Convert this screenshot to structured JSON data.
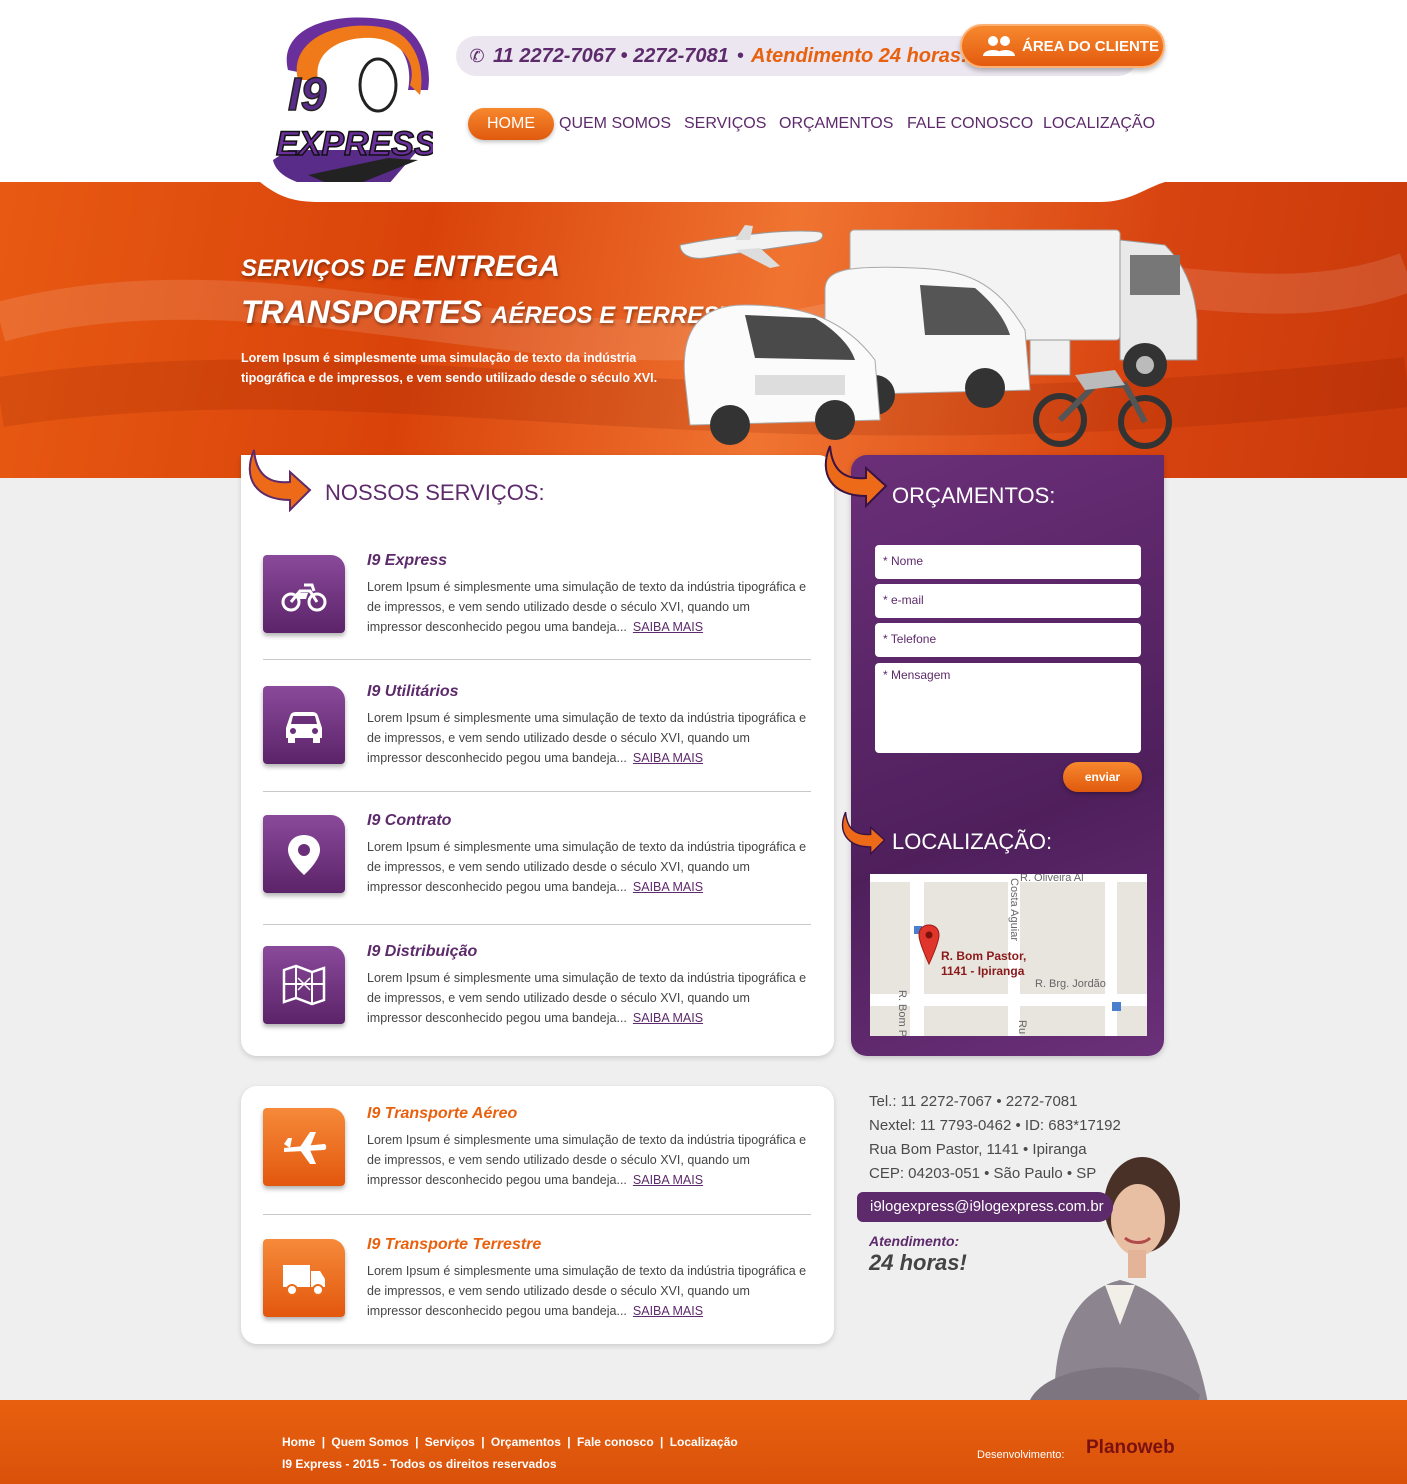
{
  "header": {
    "logo_text_top": "I9",
    "logo_text_bottom": "EXPRESS",
    "phone": "11 2272-7067 • 2272-7081",
    "separator": "•",
    "atendimento": "Atendimento 24 horas!",
    "client_area": "ÁREA DO CLIENTE"
  },
  "nav": {
    "items": [
      "HOME",
      "QUEM SOMOS",
      "SERVIÇOS",
      "ORÇAMENTOS",
      "FALE CONOSCO",
      "LOCALIZAÇÃO"
    ]
  },
  "banner": {
    "line1_small": "SERVIÇOS DE",
    "line1_big": "ENTREGA",
    "line2_big": "TRANSPORTES",
    "line2_small": "AÉREOS E TERRESTRES",
    "description": "Lorem Ipsum é simplesmente uma simulação de texto da indústria tipográfica e de impressos, e vem sendo utilizado desde o século XVI."
  },
  "services": {
    "heading": "NOSSOS SERVIÇOS:",
    "more": "SAIBA MAIS",
    "text": "Lorem Ipsum é simplesmente uma simulação de texto da indústria tipográfica e de impressos, e vem sendo utilizado desde o século XVI, quando um impressor desconhecido pegou uma bandeja...",
    "items": [
      {
        "title": "I9 Express",
        "icon": "motorcycle-icon"
      },
      {
        "title": "I9 Utilitários",
        "icon": "car-icon"
      },
      {
        "title": "I9 Contrato",
        "icon": "map-pin-icon"
      },
      {
        "title": "I9 Distribuição",
        "icon": "map-icon"
      },
      {
        "title": "I9 Transporte Aéreo",
        "icon": "airplane-icon"
      },
      {
        "title": "I9 Transporte Terrestre",
        "icon": "truck-icon"
      }
    ]
  },
  "quote": {
    "heading": "ORÇAMENTOS:",
    "name_placeholder": "* Nome",
    "email_placeholder": "* e-mail",
    "phone_placeholder": "* Telefone",
    "message_placeholder": "* Mensagem",
    "send": "enviar"
  },
  "location": {
    "heading": "LOCALIZAÇÃO:",
    "map_label_line1": "R. Bom Pastor,",
    "map_label_line2": "1141 - Ipiranga",
    "street_1": "R. Brg. Jordão",
    "street_2": "R. Bom P",
    "street_3": "R. Oliveira Al",
    "street_4": "Costa Aguiar",
    "street_5": "Ru"
  },
  "contact": {
    "tel": "Tel.: 11 2272-7067 • 2272-7081",
    "nextel": "Nextel: 11 7793-0462 • ID: 683*17192",
    "address": "Rua Bom Pastor, 1141 • Ipiranga",
    "cep": "CEP: 04203-051 • São Paulo • SP",
    "email": "i9logexpress@i9logexpress.com.br",
    "atendimento_label": "Atendimento:",
    "atendimento_value": "24 horas!"
  },
  "footer": {
    "links": [
      "Home",
      "Quem Somos",
      "Serviços",
      "Orçamentos",
      "Fale conosco",
      "Localização"
    ],
    "link_separator": "|",
    "copyright": "I9 Express - 2015 - Todos os direitos reservados",
    "dev_label": "Desenvolvimento:",
    "dev_name": "Planoweb"
  },
  "colors": {
    "purple": "#5d2a6b",
    "orange": "#e8610f"
  }
}
